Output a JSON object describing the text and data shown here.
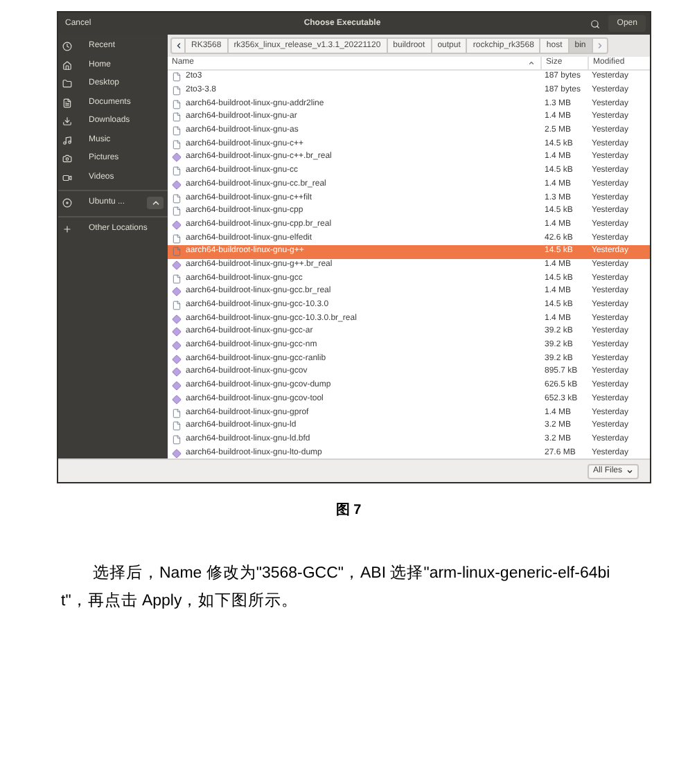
{
  "dialog": {
    "cancel": "Cancel",
    "title": "Choose Executable",
    "open": "Open",
    "sidebar": [
      {
        "kind": "place",
        "label": "Recent"
      },
      {
        "kind": "place",
        "label": "Home"
      },
      {
        "kind": "place",
        "label": "Desktop"
      },
      {
        "kind": "place",
        "label": "Documents"
      },
      {
        "kind": "place",
        "label": "Downloads"
      },
      {
        "kind": "place",
        "label": "Music"
      },
      {
        "kind": "place",
        "label": "Pictures"
      },
      {
        "kind": "place",
        "label": "Videos"
      },
      {
        "kind": "device",
        "label": "Ubuntu ...",
        "eject": true
      },
      {
        "kind": "action",
        "label": "Other Locations"
      }
    ],
    "path": [
      {
        "label": "RK3568",
        "selected": false
      },
      {
        "label": "rk356x_linux_release_v1.3.1_20221120",
        "selected": false
      },
      {
        "label": "buildroot",
        "selected": false
      },
      {
        "label": "output",
        "selected": false
      },
      {
        "label": "rockchip_rk3568",
        "selected": false
      },
      {
        "label": "host",
        "selected": false
      },
      {
        "label": "bin",
        "selected": true
      }
    ],
    "columns": [
      "Name",
      "Size",
      "Modified"
    ],
    "rows": [
      {
        "kind": "file",
        "name": "2to3",
        "size": "187 bytes",
        "modified": "Yesterday",
        "selected": false
      },
      {
        "kind": "file",
        "name": "2to3-3.8",
        "size": "187 bytes",
        "modified": "Yesterday",
        "selected": false
      },
      {
        "kind": "file",
        "name": "aarch64-buildroot-linux-gnu-addr2line",
        "size": "1.3 MB",
        "modified": "Yesterday",
        "selected": false
      },
      {
        "kind": "file",
        "name": "aarch64-buildroot-linux-gnu-ar",
        "size": "1.4 MB",
        "modified": "Yesterday",
        "selected": false
      },
      {
        "kind": "file",
        "name": "aarch64-buildroot-linux-gnu-as",
        "size": "2.5 MB",
        "modified": "Yesterday",
        "selected": false
      },
      {
        "kind": "file",
        "name": "aarch64-buildroot-linux-gnu-c++",
        "size": "14.5 kB",
        "modified": "Yesterday",
        "selected": false
      },
      {
        "kind": "exec",
        "name": "aarch64-buildroot-linux-gnu-c++.br_real",
        "size": "1.4 MB",
        "modified": "Yesterday",
        "selected": false
      },
      {
        "kind": "file",
        "name": "aarch64-buildroot-linux-gnu-cc",
        "size": "14.5 kB",
        "modified": "Yesterday",
        "selected": false
      },
      {
        "kind": "exec",
        "name": "aarch64-buildroot-linux-gnu-cc.br_real",
        "size": "1.4 MB",
        "modified": "Yesterday",
        "selected": false
      },
      {
        "kind": "file",
        "name": "aarch64-buildroot-linux-gnu-c++filt",
        "size": "1.3 MB",
        "modified": "Yesterday",
        "selected": false
      },
      {
        "kind": "file",
        "name": "aarch64-buildroot-linux-gnu-cpp",
        "size": "14.5 kB",
        "modified": "Yesterday",
        "selected": false
      },
      {
        "kind": "exec",
        "name": "aarch64-buildroot-linux-gnu-cpp.br_real",
        "size": "1.4 MB",
        "modified": "Yesterday",
        "selected": false
      },
      {
        "kind": "file",
        "name": "aarch64-buildroot-linux-gnu-elfedit",
        "size": "42.6 kB",
        "modified": "Yesterday",
        "selected": false
      },
      {
        "kind": "file",
        "name": "aarch64-buildroot-linux-gnu-g++",
        "size": "14.5 kB",
        "modified": "Yesterday",
        "selected": true
      },
      {
        "kind": "exec",
        "name": "aarch64-buildroot-linux-gnu-g++.br_real",
        "size": "1.4 MB",
        "modified": "Yesterday",
        "selected": false
      },
      {
        "kind": "file",
        "name": "aarch64-buildroot-linux-gnu-gcc",
        "size": "14.5 kB",
        "modified": "Yesterday",
        "selected": false
      },
      {
        "kind": "exec",
        "name": "aarch64-buildroot-linux-gnu-gcc.br_real",
        "size": "1.4 MB",
        "modified": "Yesterday",
        "selected": false
      },
      {
        "kind": "file",
        "name": "aarch64-buildroot-linux-gnu-gcc-10.3.0",
        "size": "14.5 kB",
        "modified": "Yesterday",
        "selected": false
      },
      {
        "kind": "exec",
        "name": "aarch64-buildroot-linux-gnu-gcc-10.3.0.br_real",
        "size": "1.4 MB",
        "modified": "Yesterday",
        "selected": false
      },
      {
        "kind": "exec",
        "name": "aarch64-buildroot-linux-gnu-gcc-ar",
        "size": "39.2 kB",
        "modified": "Yesterday",
        "selected": false
      },
      {
        "kind": "exec",
        "name": "aarch64-buildroot-linux-gnu-gcc-nm",
        "size": "39.2 kB",
        "modified": "Yesterday",
        "selected": false
      },
      {
        "kind": "exec",
        "name": "aarch64-buildroot-linux-gnu-gcc-ranlib",
        "size": "39.2 kB",
        "modified": "Yesterday",
        "selected": false
      },
      {
        "kind": "exec",
        "name": "aarch64-buildroot-linux-gnu-gcov",
        "size": "895.7 kB",
        "modified": "Yesterday",
        "selected": false
      },
      {
        "kind": "exec",
        "name": "aarch64-buildroot-linux-gnu-gcov-dump",
        "size": "626.5 kB",
        "modified": "Yesterday",
        "selected": false
      },
      {
        "kind": "exec",
        "name": "aarch64-buildroot-linux-gnu-gcov-tool",
        "size": "652.3 kB",
        "modified": "Yesterday",
        "selected": false
      },
      {
        "kind": "file",
        "name": "aarch64-buildroot-linux-gnu-gprof",
        "size": "1.4 MB",
        "modified": "Yesterday",
        "selected": false
      },
      {
        "kind": "file",
        "name": "aarch64-buildroot-linux-gnu-ld",
        "size": "3.2 MB",
        "modified": "Yesterday",
        "selected": false
      },
      {
        "kind": "file",
        "name": "aarch64-buildroot-linux-gnu-ld.bfd",
        "size": "3.2 MB",
        "modified": "Yesterday",
        "selected": false
      },
      {
        "kind": "exec",
        "name": "aarch64-buildroot-linux-gnu-lto-dump",
        "size": "27.6 MB",
        "modified": "Yesterday",
        "selected": false
      }
    ],
    "filter": "All Files"
  },
  "caption": "图 7",
  "paragraph": "选择后，Name 修改为\"3568-GCC\"，ABI 选择\"arm-linux-generic-elf-64bit\"，再点击 Apply，如下图所示。"
}
